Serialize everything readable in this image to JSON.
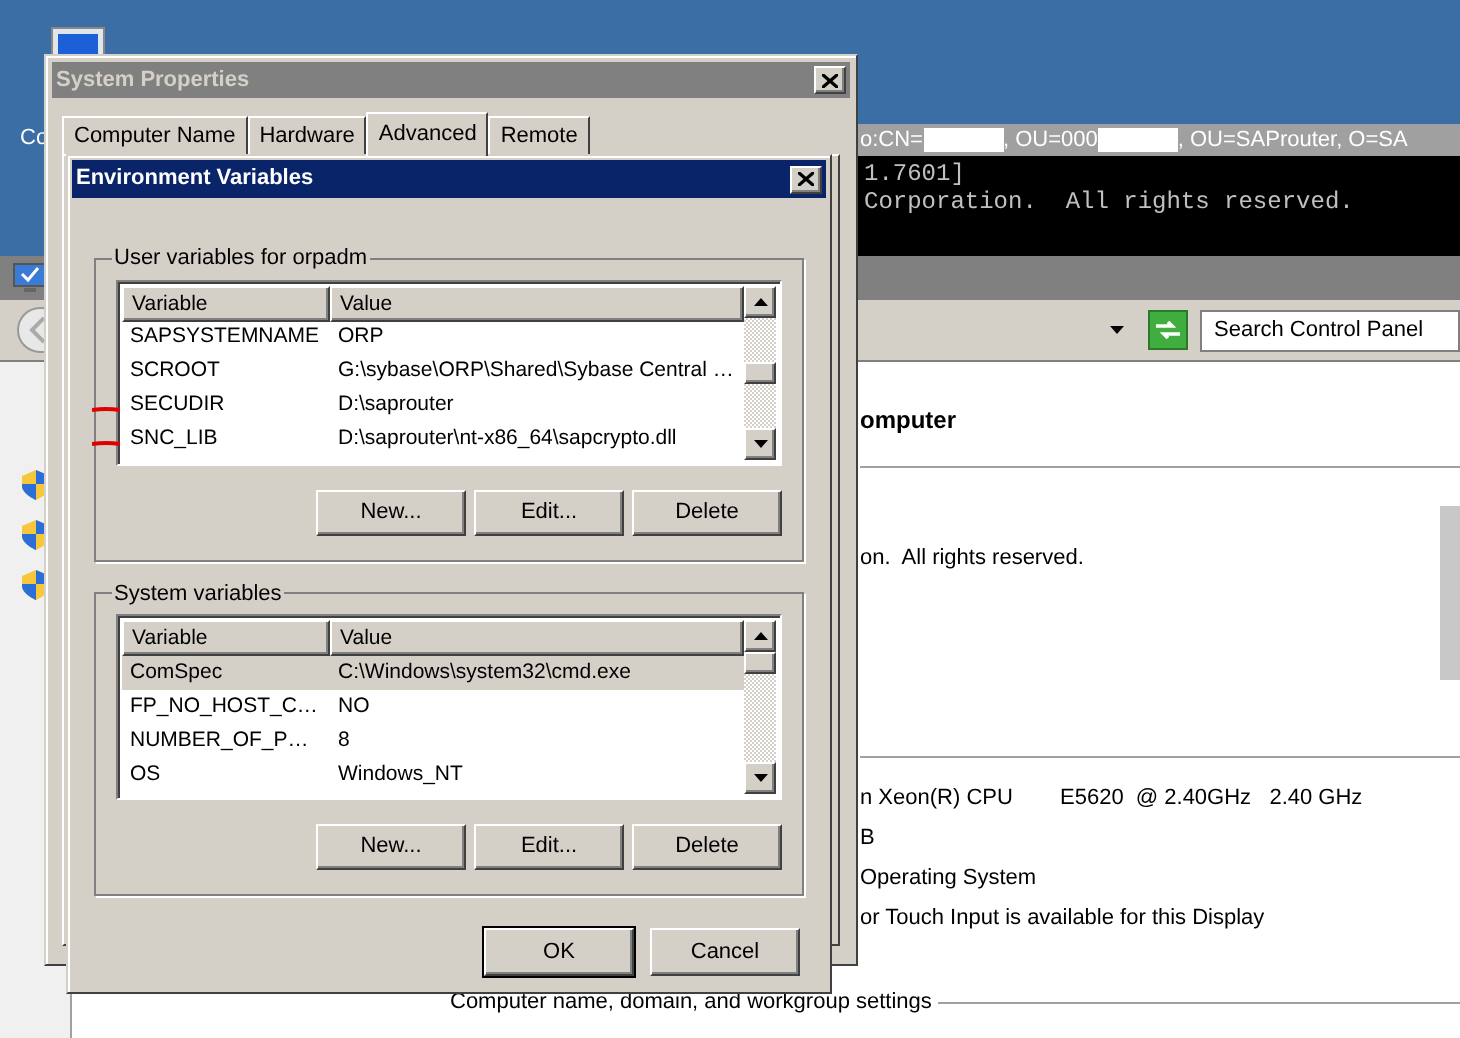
{
  "desktop": {
    "icon_label": "Co"
  },
  "console": {
    "title_parts": [
      "o:CN=",
      ", OU=000",
      ", OU=SAProuter, O=SA"
    ],
    "lines": [
      "1.7601]",
      "Corporation.  All rights reserved."
    ]
  },
  "control_panel": {
    "search": {
      "placeholder": "Search Control Panel"
    },
    "heading": "omputer",
    "copyright": "on.  All rights reserved.",
    "specs": [
      {
        "label": "n Xeon(R) CPU",
        "value": "E5620  @ 2.40GHz   2.40 GHz"
      },
      {
        "label": "B"
      },
      {
        "label": "Operating System"
      },
      {
        "label": "or Touch Input is available for this Display"
      }
    ],
    "section": "Computer name, domain, and workgroup settings"
  },
  "system_properties": {
    "title": "System Properties",
    "tabs": [
      {
        "label": "Computer Name",
        "selected": false
      },
      {
        "label": "Hardware",
        "selected": false
      },
      {
        "label": "Advanced",
        "selected": true
      },
      {
        "label": "Remote",
        "selected": false
      }
    ]
  },
  "env_dialog": {
    "title": "Environment Variables",
    "groups": [
      {
        "title": "User variables for orpadm",
        "columns": [
          "Variable",
          "Value"
        ],
        "rows": [
          {
            "variable": "SAPSYSTEMNAME",
            "value": "ORP",
            "selected": false,
            "marked": false
          },
          {
            "variable": "SCROOT",
            "value": "G:\\sybase\\ORP\\Shared\\Sybase Central …",
            "selected": false,
            "marked": false
          },
          {
            "variable": "SECUDIR",
            "value": "D:\\saprouter",
            "selected": false,
            "marked": true
          },
          {
            "variable": "SNC_LIB",
            "value": "D:\\saprouter\\nt-x86_64\\sapcrypto.dll",
            "selected": false,
            "marked": true
          }
        ],
        "buttons": [
          "New...",
          "Edit...",
          "Delete"
        ]
      },
      {
        "title": "System variables",
        "columns": [
          "Variable",
          "Value"
        ],
        "rows": [
          {
            "variable": "ComSpec",
            "value": "C:\\Windows\\system32\\cmd.exe",
            "selected": true,
            "marked": false
          },
          {
            "variable": "FP_NO_HOST_C…",
            "value": "NO",
            "selected": false,
            "marked": false
          },
          {
            "variable": "NUMBER_OF_P…",
            "value": "8",
            "selected": false,
            "marked": false
          },
          {
            "variable": "OS",
            "value": "Windows_NT",
            "selected": false,
            "marked": false
          }
        ],
        "buttons": [
          "New...",
          "Edit...",
          "Delete"
        ]
      }
    ],
    "buttons": [
      {
        "label": "OK",
        "default": true
      },
      {
        "label": "Cancel",
        "default": false
      }
    ]
  }
}
